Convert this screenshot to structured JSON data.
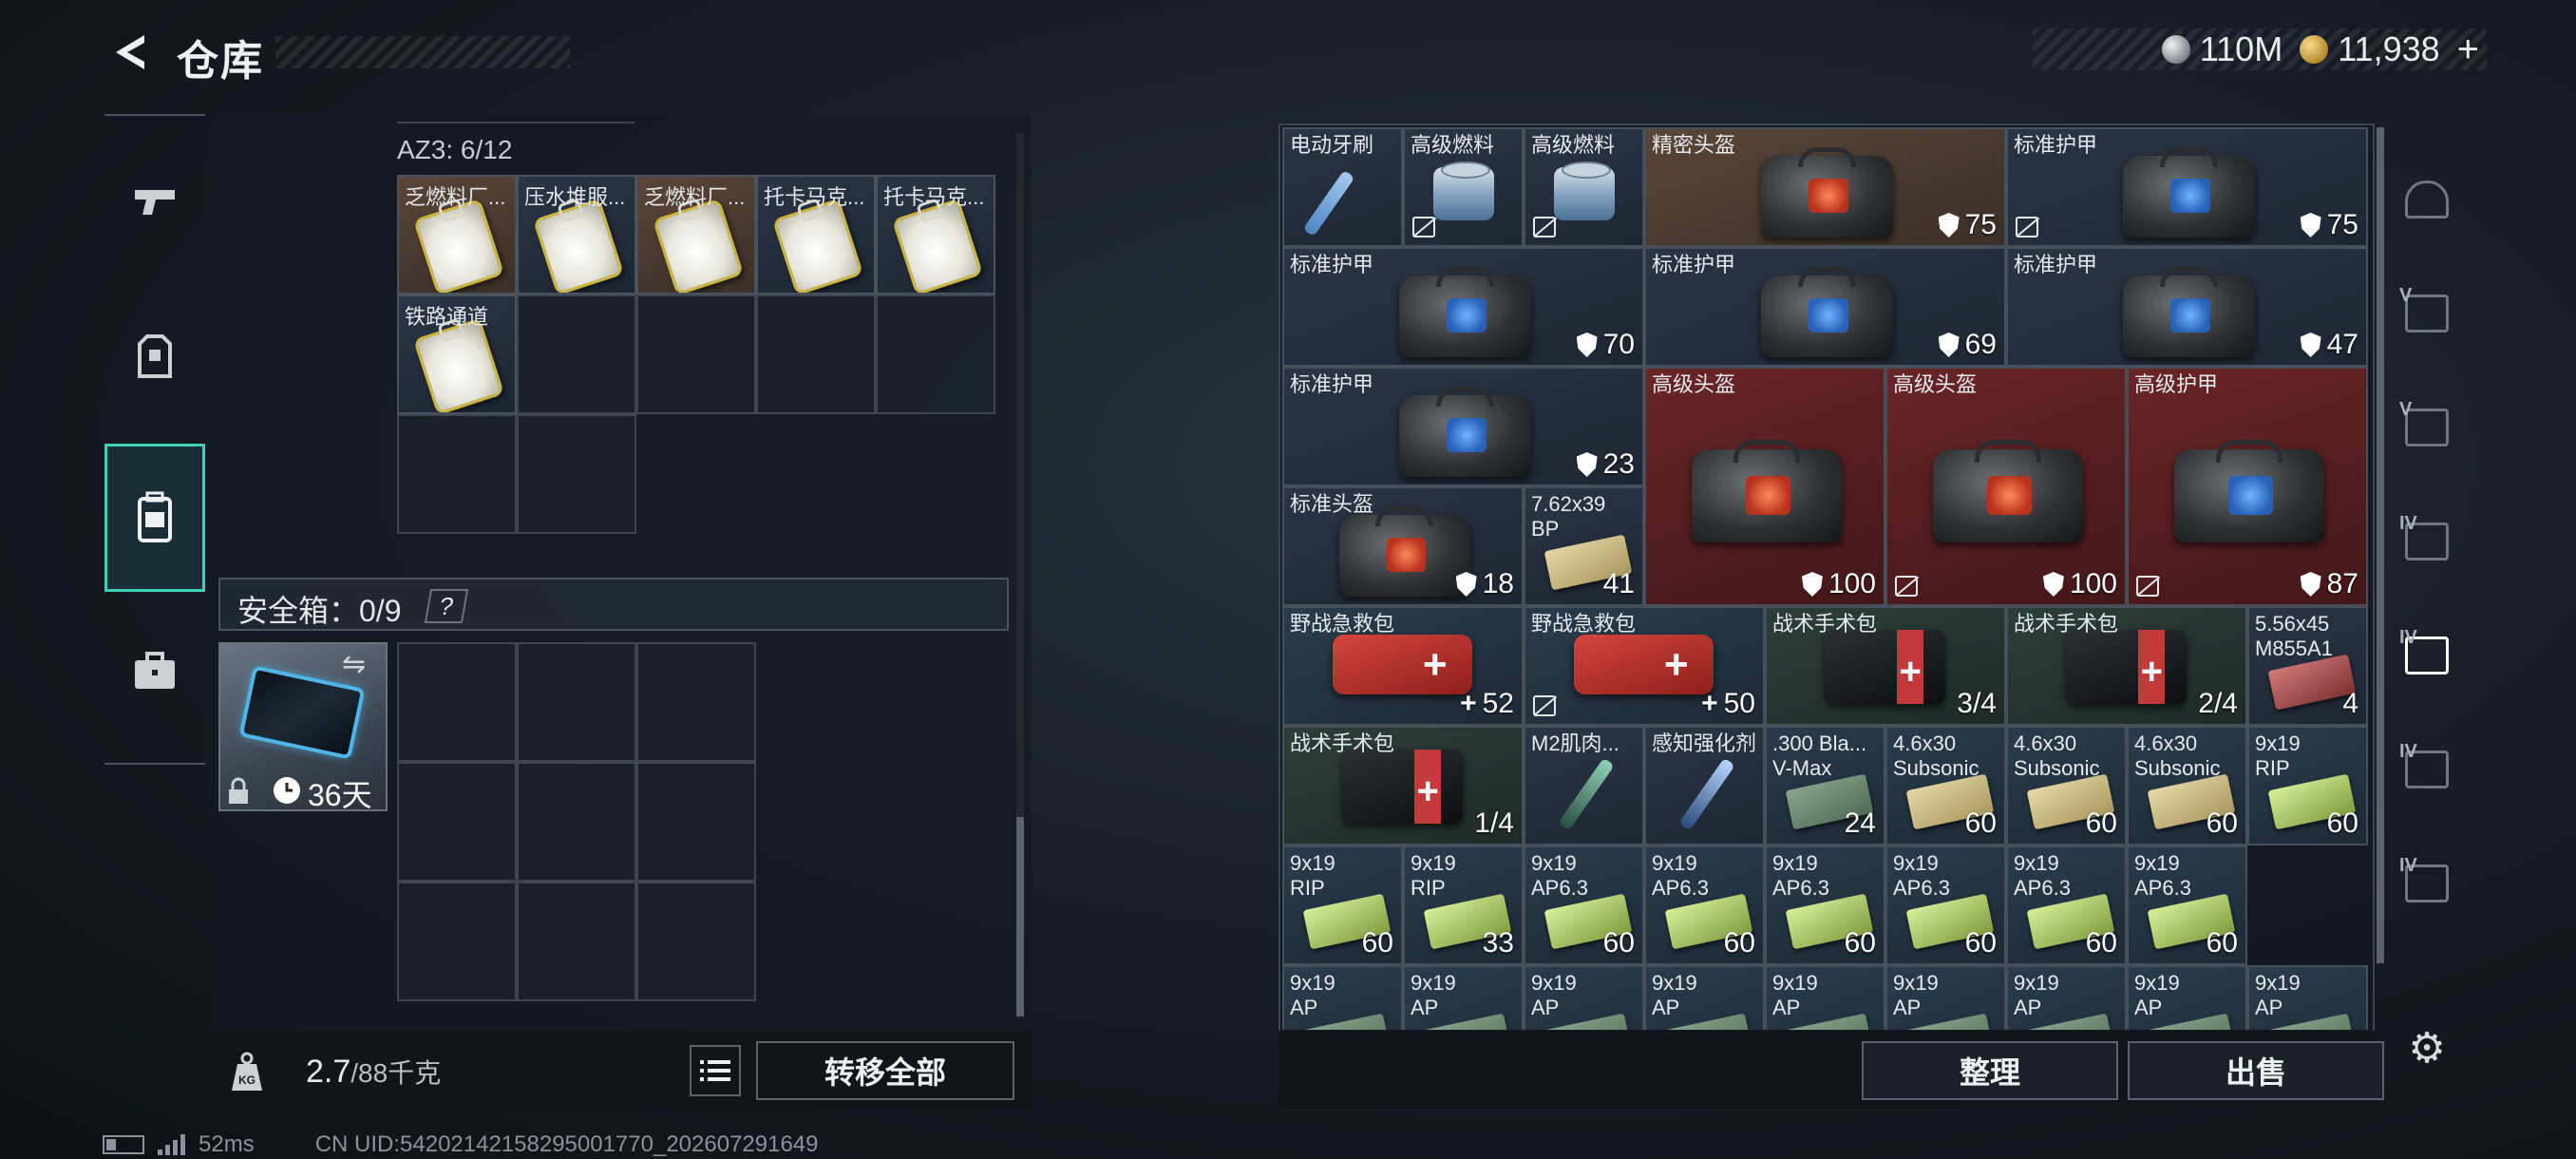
{
  "header": {
    "title": "仓库",
    "currency": [
      {
        "icon": "silver-coin-icon",
        "value": "110M"
      },
      {
        "icon": "gold-coin-icon",
        "value": "11,938"
      }
    ],
    "add_label": "+"
  },
  "left_nav": {
    "items": [
      {
        "icon": "pistol-icon",
        "active": false
      },
      {
        "icon": "armor-vest-icon",
        "active": false
      },
      {
        "icon": "backpack-icon",
        "active": true
      },
      {
        "icon": "briefcase-icon",
        "active": false
      }
    ]
  },
  "backpack": {
    "az3_label": "AZ3: 6/12",
    "items": [
      {
        "name": "乏燃料厂...",
        "bg": "brown"
      },
      {
        "name": "压水堆服...",
        "bg": "dark"
      },
      {
        "name": "乏燃料厂...",
        "bg": "brown"
      },
      {
        "name": "托卡马克...",
        "bg": "dark"
      },
      {
        "name": "托卡马克...",
        "bg": "dark"
      },
      {
        "name": "铁路通道",
        "bg": "dark"
      }
    ],
    "safebox_label": "安全箱：0/9",
    "safebox_help": "?",
    "safebox_duration": "36天",
    "weight": "2.7",
    "weight_max": "/88千克",
    "transfer_all": "转移全部"
  },
  "stash": {
    "items": [
      {
        "name": "电动牙刷",
        "art": "toothbrush",
        "bg": "dark"
      },
      {
        "name": "高级燃料",
        "art": "fuel",
        "bg": "dark",
        "nosell": true
      },
      {
        "name": "高级燃料",
        "art": "fuel",
        "bg": "dark",
        "nosell": true
      },
      {
        "name": "精密头盔",
        "art": "bag-orange",
        "bg": "brown",
        "durability": "75"
      },
      {
        "name": "标准护甲",
        "art": "bag-blue",
        "bg": "dark",
        "durability": "75",
        "nosell": true
      },
      {
        "name": "标准护甲",
        "art": "bag-blue",
        "bg": "dark",
        "durability": "70"
      },
      {
        "name": "标准护甲",
        "art": "bag-blue",
        "bg": "dark",
        "durability": "69"
      },
      {
        "name": "标准护甲",
        "art": "bag-blue",
        "bg": "dark",
        "durability": "47"
      },
      {
        "name": "标准护甲",
        "art": "bag-blue",
        "bg": "dark",
        "durability": "23"
      },
      {
        "name": "高级头盔",
        "art": "bag-orange",
        "bg": "red",
        "durability": "100"
      },
      {
        "name": "高级头盔",
        "art": "bag-orange",
        "bg": "red",
        "durability": "100",
        "nosell": true
      },
      {
        "name": "高级护甲",
        "art": "bag-blue",
        "bg": "red",
        "durability": "87",
        "nosell": true
      },
      {
        "name": "标准头盔",
        "art": "bag-orange",
        "bg": "dark",
        "durability": "18"
      },
      {
        "name": "7.62x39",
        "name2": "BP",
        "art": "ammo-tan",
        "bg": "dark",
        "qty": "41"
      },
      {
        "name": "野战急救包",
        "art": "firstaid",
        "bg": "teal",
        "qty": "52",
        "plus": true
      },
      {
        "name": "野战急救包",
        "art": "firstaid",
        "bg": "teal",
        "qty": "50",
        "plus": true,
        "nosell": true
      },
      {
        "name": "战术手术包",
        "art": "surgkit",
        "bg": "green",
        "qty": "3/4"
      },
      {
        "name": "战术手术包",
        "art": "surgkit",
        "bg": "green",
        "qty": "2/4"
      },
      {
        "name": "5.56x45",
        "name2": "M855A1",
        "art": "ammo-red",
        "bg": "dark",
        "qty": "4"
      },
      {
        "name": "战术手术包",
        "art": "surgkit",
        "bg": "green",
        "qty": "1/4"
      },
      {
        "name": "M2肌肉...",
        "art": "injector-green",
        "bg": "dark"
      },
      {
        "name": "感知强化剂",
        "art": "injector-blue",
        "bg": "dark"
      },
      {
        "name": ".300 Bla...",
        "name2": "V-Max",
        "art": "ammo-olive",
        "bg": "teal",
        "qty": "24"
      },
      {
        "name": "4.6x30",
        "name2": "Subsonic",
        "art": "ammo-tan",
        "bg": "teal",
        "qty": "60"
      },
      {
        "name": "4.6x30",
        "name2": "Subsonic",
        "art": "ammo-tan",
        "bg": "teal",
        "qty": "60"
      },
      {
        "name": "4.6x30",
        "name2": "Subsonic",
        "art": "ammo-tan",
        "bg": "teal",
        "qty": "60"
      },
      {
        "name": "9x19",
        "name2": "RIP",
        "art": "ammo-green",
        "bg": "teal",
        "qty": "60"
      },
      {
        "name": "9x19",
        "name2": "RIP",
        "art": "ammo-green",
        "bg": "teal",
        "qty": "60"
      },
      {
        "name": "9x19",
        "name2": "RIP",
        "art": "ammo-green",
        "bg": "teal",
        "qty": "33"
      },
      {
        "name": "9x19",
        "name2": "AP6.3",
        "art": "ammo-green",
        "bg": "teal",
        "qty": "60"
      },
      {
        "name": "9x19",
        "name2": "AP6.3",
        "art": "ammo-green",
        "bg": "teal",
        "qty": "60"
      },
      {
        "name": "9x19",
        "name2": "AP6.3",
        "art": "ammo-green",
        "bg": "teal",
        "qty": "60"
      },
      {
        "name": "9x19",
        "name2": "AP6.3",
        "art": "ammo-green",
        "bg": "teal",
        "qty": "60"
      },
      {
        "name": "9x19",
        "name2": "AP6.3",
        "art": "ammo-green",
        "bg": "teal",
        "qty": "60"
      },
      {
        "name": "9x19",
        "name2": "AP6.3",
        "art": "ammo-green",
        "bg": "teal",
        "qty": "60"
      },
      {
        "name": "9x19",
        "name2": "AP",
        "art": "ammo-olive",
        "bg": "teal"
      },
      {
        "name": "9x19",
        "name2": "AP",
        "art": "ammo-olive",
        "bg": "teal"
      },
      {
        "name": "9x19",
        "name2": "AP",
        "art": "ammo-olive",
        "bg": "teal"
      },
      {
        "name": "9x19",
        "name2": "AP",
        "art": "ammo-olive",
        "bg": "teal"
      },
      {
        "name": "9x19",
        "name2": "AP",
        "art": "ammo-olive",
        "bg": "teal"
      },
      {
        "name": "9x19",
        "name2": "AP",
        "art": "ammo-olive",
        "bg": "teal"
      },
      {
        "name": "9x19",
        "name2": "AP",
        "art": "ammo-olive",
        "bg": "teal"
      },
      {
        "name": "9x19",
        "name2": "AP",
        "art": "ammo-olive",
        "bg": "teal"
      },
      {
        "name": "9x19",
        "name2": "AP",
        "art": "ammo-olive",
        "bg": "teal"
      }
    ],
    "sort_label": "整理",
    "sell_label": "出售"
  },
  "right_tabs": [
    {
      "label": "",
      "icon": "safehouse-icon",
      "active": false
    },
    {
      "label": "V",
      "icon": "crate-v-icon",
      "active": false
    },
    {
      "label": "V",
      "icon": "crate-v-icon",
      "active": false
    },
    {
      "label": "IV",
      "icon": "crate-iv-icon",
      "active": false
    },
    {
      "label": "IV",
      "icon": "crate-iv-icon",
      "active": true
    },
    {
      "label": "IV",
      "icon": "crate-iv-icon",
      "active": false
    },
    {
      "label": "IV",
      "icon": "crate-iv-icon",
      "active": false
    }
  ],
  "status": {
    "ping": "52ms",
    "uid": "CN UID:542021421582950017​70_202607291649"
  }
}
